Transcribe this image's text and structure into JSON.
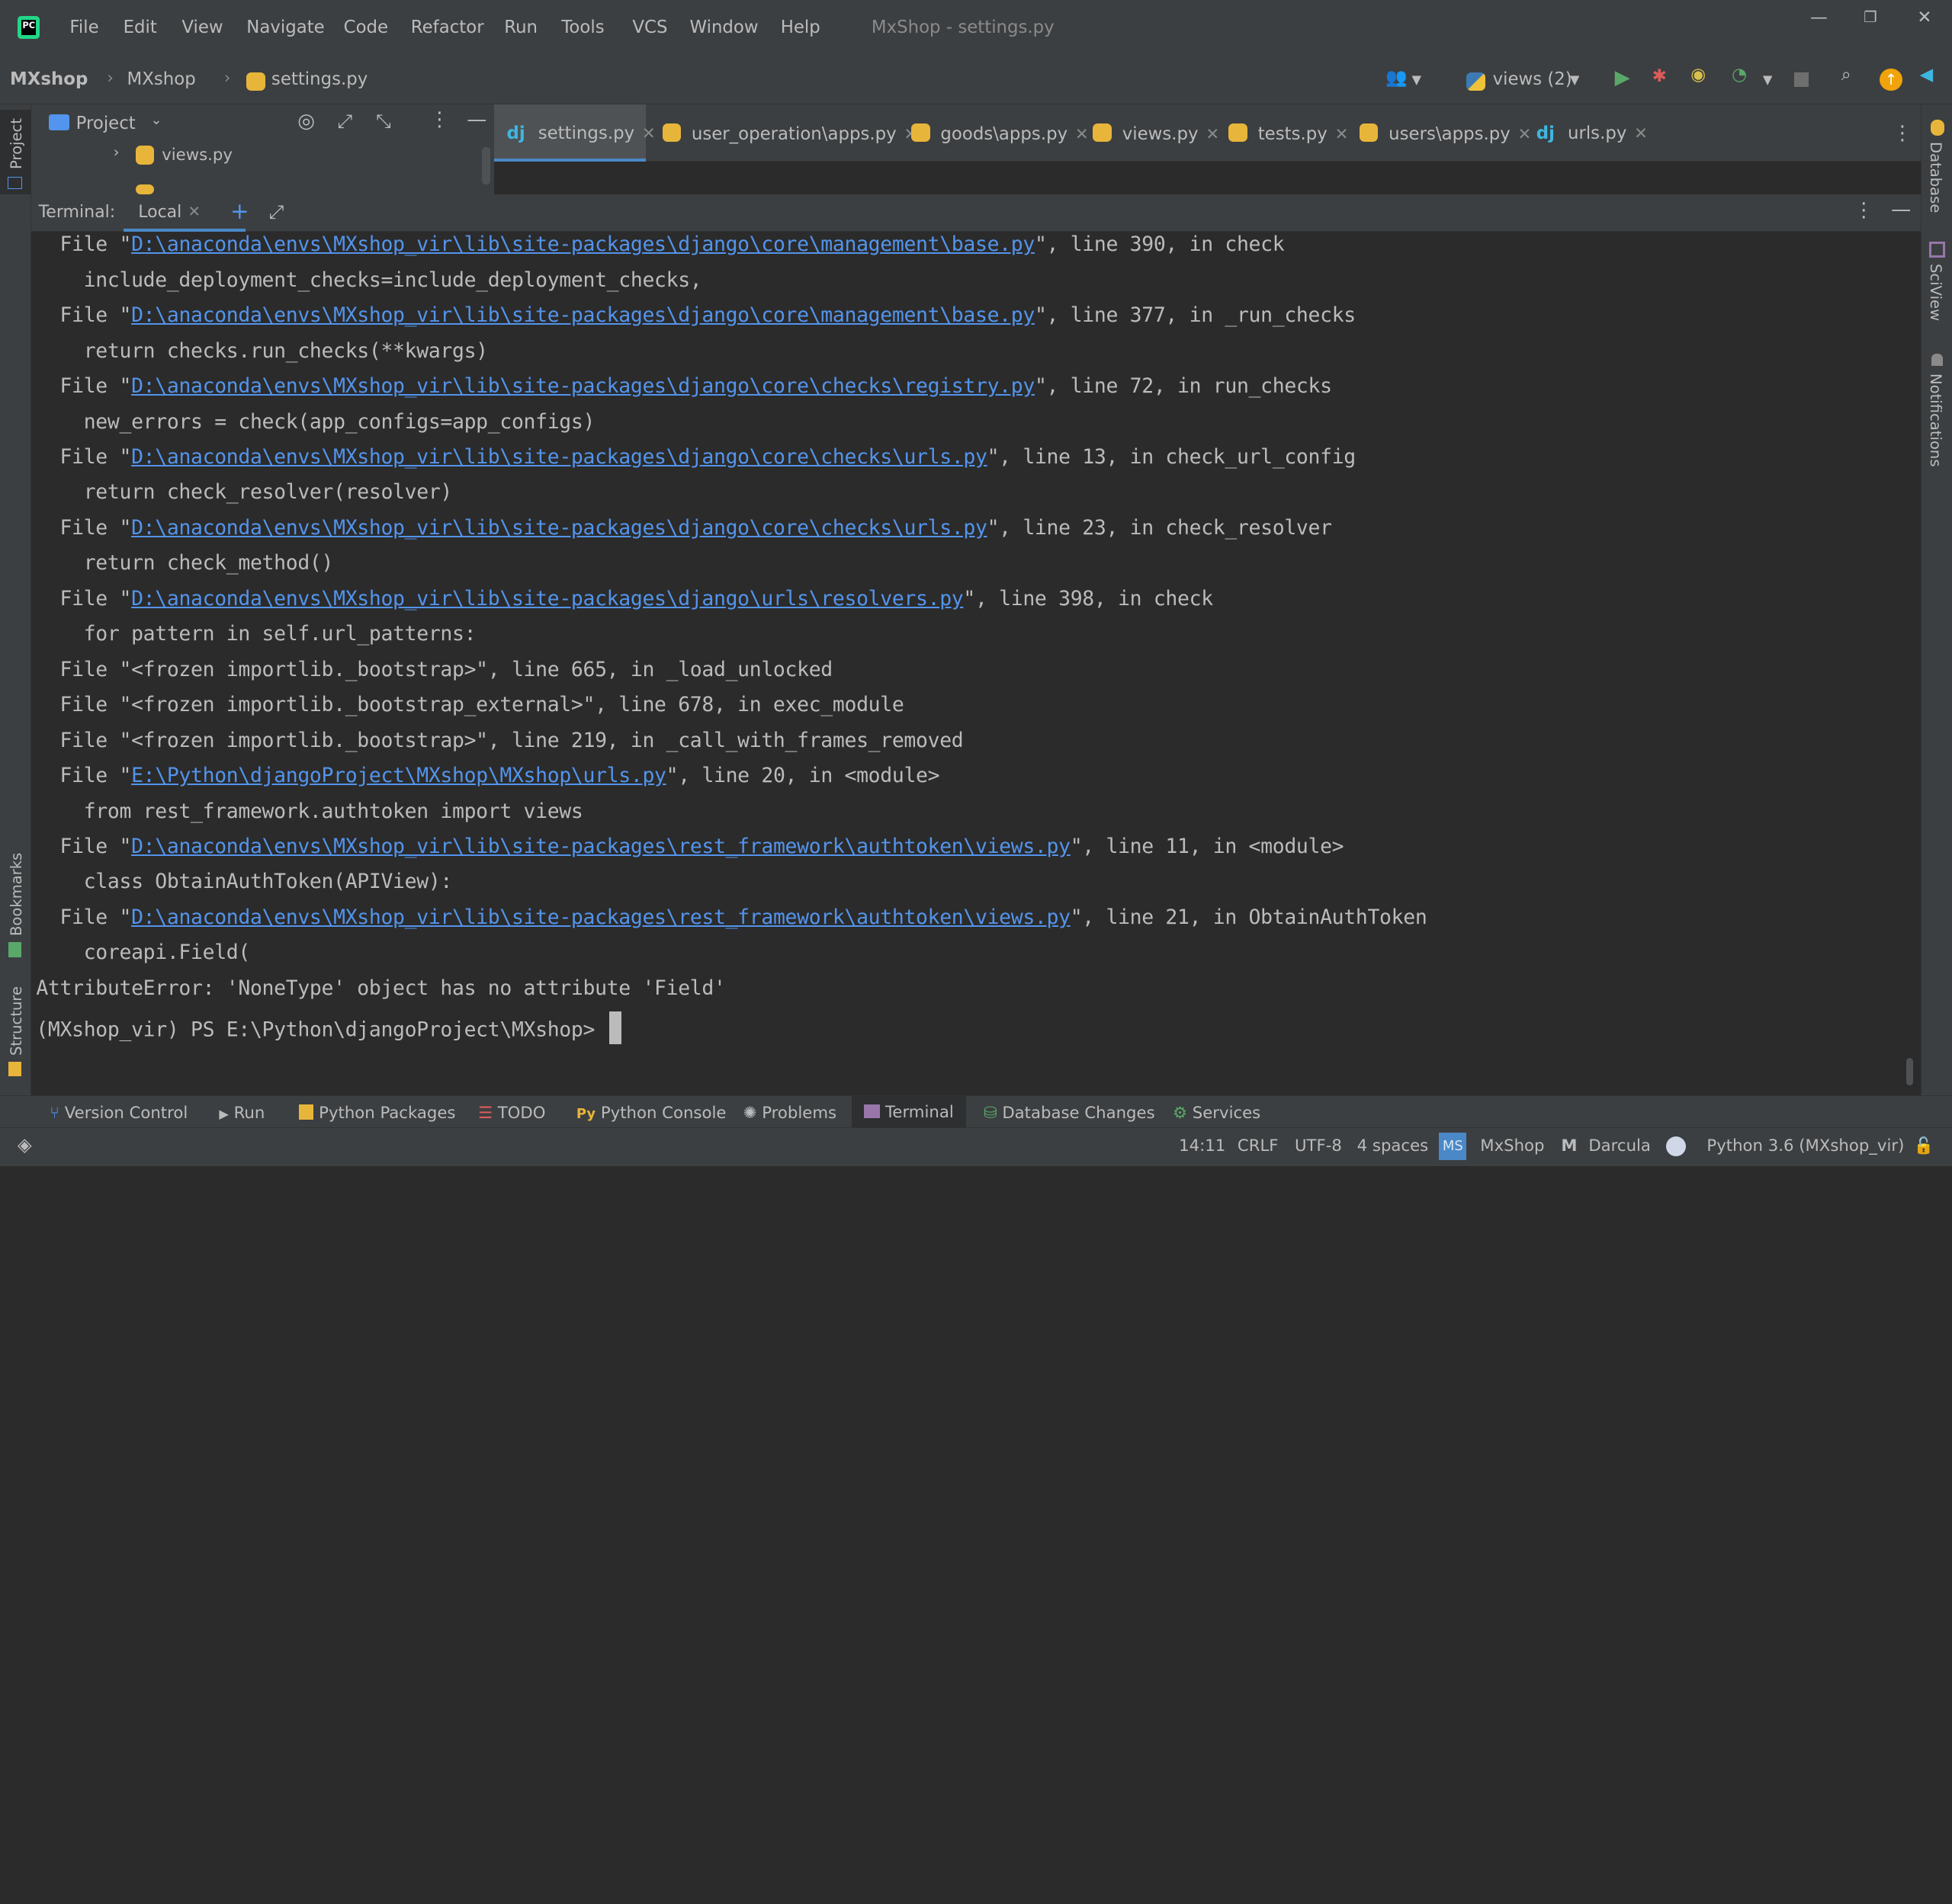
{
  "window": {
    "title": "MxShop - settings.py",
    "menu": [
      "File",
      "Edit",
      "View",
      "Navigate",
      "Code",
      "Refactor",
      "Run",
      "Tools",
      "VCS",
      "Window",
      "Help"
    ]
  },
  "breadcrumbs": {
    "project": "MXshop",
    "folder": "MXshop",
    "file": "settings.py"
  },
  "toolbar": {
    "run_config": "views (2)"
  },
  "project_panel": {
    "title": "Project",
    "tree_item": "views.py"
  },
  "editor_tabs": [
    {
      "label": "settings.py",
      "icon": "django-icon",
      "active": true
    },
    {
      "label": "user_operation\\apps.py",
      "icon": "python-file-icon"
    },
    {
      "label": "goods\\apps.py",
      "icon": "python-file-icon"
    },
    {
      "label": "views.py",
      "icon": "python-file-icon"
    },
    {
      "label": "tests.py",
      "icon": "python-file-icon"
    },
    {
      "label": "users\\apps.py",
      "icon": "python-file-icon"
    },
    {
      "label": "urls.py",
      "icon": "django-icon"
    }
  ],
  "terminal": {
    "label": "Terminal:",
    "tab": "Local",
    "lines": [
      {
        "pre": "  File \"",
        "link": "D:\\anaconda\\envs\\MXshop_vir\\lib\\site-packages\\django\\core\\management\\base.py",
        "post": "\", line 390, in check"
      },
      {
        "pre": "    include_deployment_checks=include_deployment_checks,"
      },
      {
        "pre": "  File \"",
        "link": "D:\\anaconda\\envs\\MXshop_vir\\lib\\site-packages\\django\\core\\management\\base.py",
        "post": "\", line 377, in _run_checks"
      },
      {
        "pre": "    return checks.run_checks(**kwargs)"
      },
      {
        "pre": "  File \"",
        "link": "D:\\anaconda\\envs\\MXshop_vir\\lib\\site-packages\\django\\core\\checks\\registry.py",
        "post": "\", line 72, in run_checks"
      },
      {
        "pre": "    new_errors = check(app_configs=app_configs)"
      },
      {
        "pre": "  File \"",
        "link": "D:\\anaconda\\envs\\MXshop_vir\\lib\\site-packages\\django\\core\\checks\\urls.py",
        "post": "\", line 13, in check_url_config"
      },
      {
        "pre": "    return check_resolver(resolver)"
      },
      {
        "pre": "  File \"",
        "link": "D:\\anaconda\\envs\\MXshop_vir\\lib\\site-packages\\django\\core\\checks\\urls.py",
        "post": "\", line 23, in check_resolver"
      },
      {
        "pre": "    return check_method()"
      },
      {
        "pre": "  File \"",
        "link": "D:\\anaconda\\envs\\MXshop_vir\\lib\\site-packages\\django\\urls\\resolvers.py",
        "post": "\", line 398, in check"
      },
      {
        "pre": "    for pattern in self.url_patterns:"
      },
      {
        "pre": "  File \"<frozen importlib._bootstrap>\", line 665, in _load_unlocked"
      },
      {
        "pre": "  File \"<frozen importlib._bootstrap_external>\", line 678, in exec_module"
      },
      {
        "pre": "  File \"<frozen importlib._bootstrap>\", line 219, in _call_with_frames_removed"
      },
      {
        "pre": "  File \"",
        "link": "E:\\Python\\djangoProject\\MXshop\\MXshop\\urls.py",
        "post": "\", line 20, in <module>"
      },
      {
        "pre": "    from rest_framework.authtoken import views"
      },
      {
        "pre": "  File \"",
        "link": "D:\\anaconda\\envs\\MXshop_vir\\lib\\site-packages\\rest_framework\\authtoken\\views.py",
        "post": "\", line 11, in <module>"
      },
      {
        "pre": "    class ObtainAuthToken(APIView):"
      },
      {
        "pre": "  File \"",
        "link": "D:\\anaconda\\envs\\MXshop_vir\\lib\\site-packages\\rest_framework\\authtoken\\views.py",
        "post": "\", line 21, in ObtainAuthToken"
      },
      {
        "pre": "    coreapi.Field("
      },
      {
        "pre": "AttributeError: 'NoneType' object has no attribute 'Field'"
      },
      {
        "pre": "(MXshop_vir) PS E:\\Python\\djangoProject\\MXshop> ",
        "cursor": true
      }
    ]
  },
  "left_strip": {
    "project": "Project",
    "bookmarks": "Bookmarks",
    "structure": "Structure"
  },
  "right_strip": {
    "database": "Database",
    "sciview": "SciView",
    "notifications": "Notifications"
  },
  "bottom_tools": [
    {
      "label": "Version Control",
      "icon": "branch-icon"
    },
    {
      "label": "Run",
      "icon": "run-icon"
    },
    {
      "label": "Python Packages",
      "icon": "packages-icon"
    },
    {
      "label": "TODO",
      "icon": "todo-icon"
    },
    {
      "label": "Python Console",
      "icon": "python-console-icon"
    },
    {
      "label": "Problems",
      "icon": "problems-icon"
    },
    {
      "label": "Terminal",
      "icon": "terminal-icon",
      "active": true
    },
    {
      "label": "Database Changes",
      "icon": "database-changes-icon"
    },
    {
      "label": "Services",
      "icon": "services-icon"
    }
  ],
  "status": {
    "position": "14:11",
    "line_sep": "CRLF",
    "encoding": "UTF-8",
    "indent": "4 spaces",
    "project_badge": "MS",
    "project": "MxShop",
    "theme": "Darcula",
    "interpreter": "Python 3.6 (MXshop_vir)"
  },
  "colors": {
    "link": "#5394ec",
    "accent": "#4a88c7",
    "run_green": "#59a869",
    "debug_red": "#db5c5c"
  }
}
